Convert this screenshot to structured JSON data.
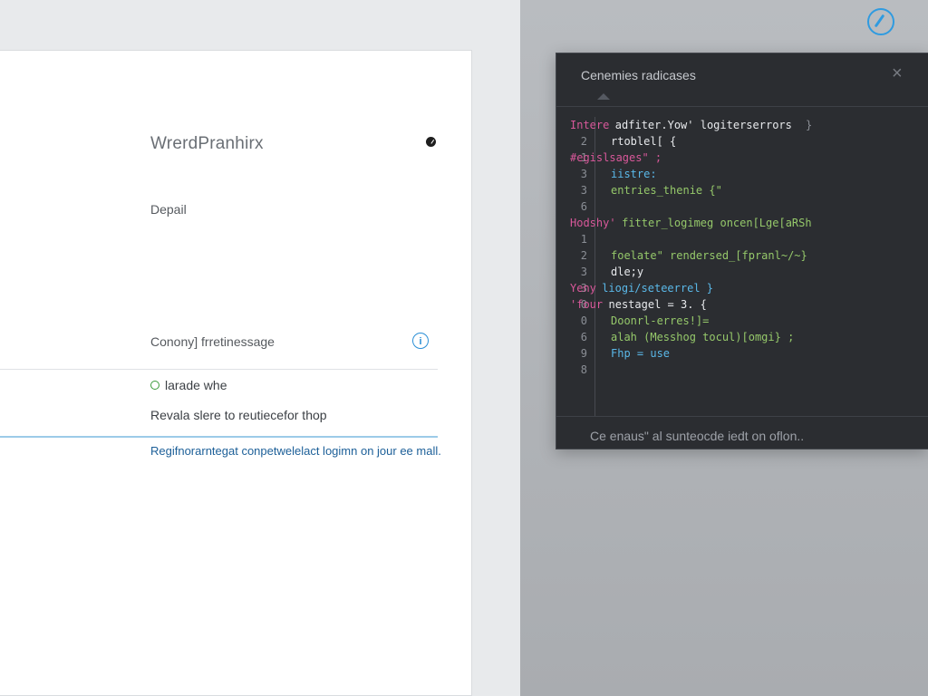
{
  "card": {
    "plugin_title": "WrerdPranhirx",
    "detail_label": "Depail",
    "config_label": "Conony] frretinessage",
    "info_icon": "i",
    "radio_label": "larade whe",
    "reveal_text": "Revala slere to reutiecefor thop",
    "register_link": "Regifnorarntegat conpetwelelact logimn on jour ee mall."
  },
  "panel": {
    "title": "Cenemies radicases",
    "close": "×",
    "footer": "Ce enaus\" al sunteocde iedt on oflon..",
    "code_lines": [
      {
        "ln": "",
        "prefix": "Intere",
        "text": "adfiter.Yow' logiterserrors",
        "suffix": "}",
        "prefix_color": "#d8589a",
        "text_color": "#e7e9ec"
      },
      {
        "ln": "2",
        "prefix": "",
        "text": "rtoblel[ {",
        "suffix": "",
        "prefix_color": "#d8589a",
        "text_color": "#e7e9ec"
      },
      {
        "ln": "1",
        "prefix": "#egislsages\" ;",
        "text": "",
        "suffix": "",
        "prefix_color": "#d8589a",
        "text_color": "#95c86a"
      },
      {
        "ln": "3",
        "prefix": "",
        "text": "iistre:",
        "suffix": "",
        "prefix_color": "#d8589a",
        "text_color": "#5ab8e8"
      },
      {
        "ln": "3",
        "prefix": "",
        "text": "entries_thenie {\"",
        "suffix": "",
        "prefix_color": "#d8589a",
        "text_color": "#95c86a"
      },
      {
        "ln": "6",
        "prefix": "",
        "text": "",
        "suffix": "",
        "prefix_color": "#d8589a",
        "text_color": "#e7e9ec"
      },
      {
        "ln": "",
        "prefix": "Hodshy'",
        "text": "fitter_logimeg oncen[Lge[aRSh",
        "suffix": "",
        "prefix_color": "#d8589a",
        "text_color": "#95c86a"
      },
      {
        "ln": "1",
        "prefix": "",
        "text": "",
        "suffix": "",
        "prefix_color": "#d8589a",
        "text_color": "#e7e9ec"
      },
      {
        "ln": "2",
        "prefix": "",
        "text": "foelate\" rendersed_[fpranl~/~}",
        "suffix": "",
        "prefix_color": "#d8589a",
        "text_color": "#95c86a"
      },
      {
        "ln": "3",
        "prefix": "",
        "text": "dle;y",
        "suffix": "",
        "prefix_color": "#d8589a",
        "text_color": "#e7e9ec"
      },
      {
        "ln": "3",
        "prefix": "Yeny",
        "text": "liogi/seteerrel }",
        "suffix": "",
        "prefix_color": "#d8589a",
        "text_color": "#5ab8e8"
      },
      {
        "ln": "0",
        "prefix": "'four",
        "text": "nestagel = 3. {",
        "suffix": "",
        "prefix_color": "#d8589a",
        "text_color": "#e7e9ec"
      },
      {
        "ln": "0",
        "prefix": "",
        "text": "Doonrl-erres!]=",
        "suffix": "",
        "prefix_color": "#d8589a",
        "text_color": "#95c86a"
      },
      {
        "ln": "6",
        "prefix": "",
        "text": "alah (Messhog tocul)[omgi} ;",
        "suffix": "",
        "prefix_color": "#d8589a",
        "text_color": "#95c86a"
      },
      {
        "ln": "9",
        "prefix": "",
        "text": "Fhp = use",
        "suffix": "",
        "prefix_color": "#d8589a",
        "text_color": "#5ab8e8"
      },
      {
        "ln": "8",
        "prefix": "",
        "text": "",
        "suffix": "",
        "prefix_color": "#d8589a",
        "text_color": "#e7e9ec"
      }
    ]
  }
}
